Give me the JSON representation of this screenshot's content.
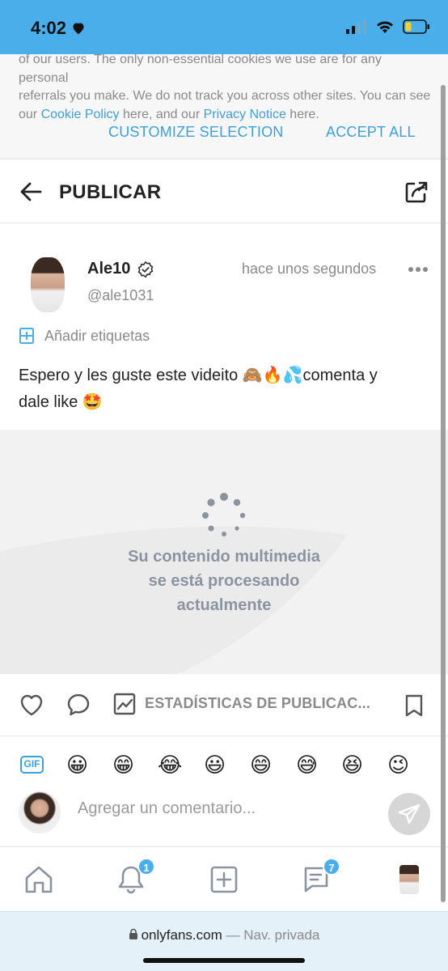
{
  "status_bar": {
    "time": "4:02"
  },
  "cookie_banner": {
    "text_line1": "of our users. The only non-essential cookies we use are for any personal",
    "text_line2": "referrals you make. We do not track you across other sites. You can see",
    "text_line3_prefix": "our ",
    "cookie_policy_link": "Cookie Policy",
    "text_middle": " here, and our ",
    "privacy_link": "Privacy Notice",
    "text_suffix": " here.",
    "customize_label": "CUSTOMIZE SELECTION",
    "accept_label": "ACCEPT ALL"
  },
  "header": {
    "title": "PUBLICAR"
  },
  "post": {
    "display_name": "Ale10",
    "handle": "@ale1031",
    "timestamp": "hace unos segundos",
    "tags_label": "Añadir etiquetas",
    "text_line1": "Espero y les guste este videito 🙈🔥💦comenta y",
    "text_line2": "dale like 🤩",
    "media_line1": "Su contenido multimedia",
    "media_line2": "se está procesando",
    "media_line3": "actualmente"
  },
  "actions": {
    "stats_label": "ESTADÍSTICAS DE PUBLICAC..."
  },
  "emoji_bar": {
    "gif_label": "GIF",
    "emojis": [
      "😀",
      "😁",
      "😂",
      "😃",
      "😄",
      "😅",
      "😆",
      "😉"
    ]
  },
  "comment": {
    "placeholder": "Agregar un comentario..."
  },
  "bottom_nav": {
    "notifications_badge": "1",
    "messages_badge": "7"
  },
  "browser": {
    "domain": "onlyfans.com",
    "mode": " — Nav. privada"
  },
  "colors": {
    "accent": "#4aaeea",
    "link": "#3d9fdb",
    "muted": "#8a8a8a"
  }
}
